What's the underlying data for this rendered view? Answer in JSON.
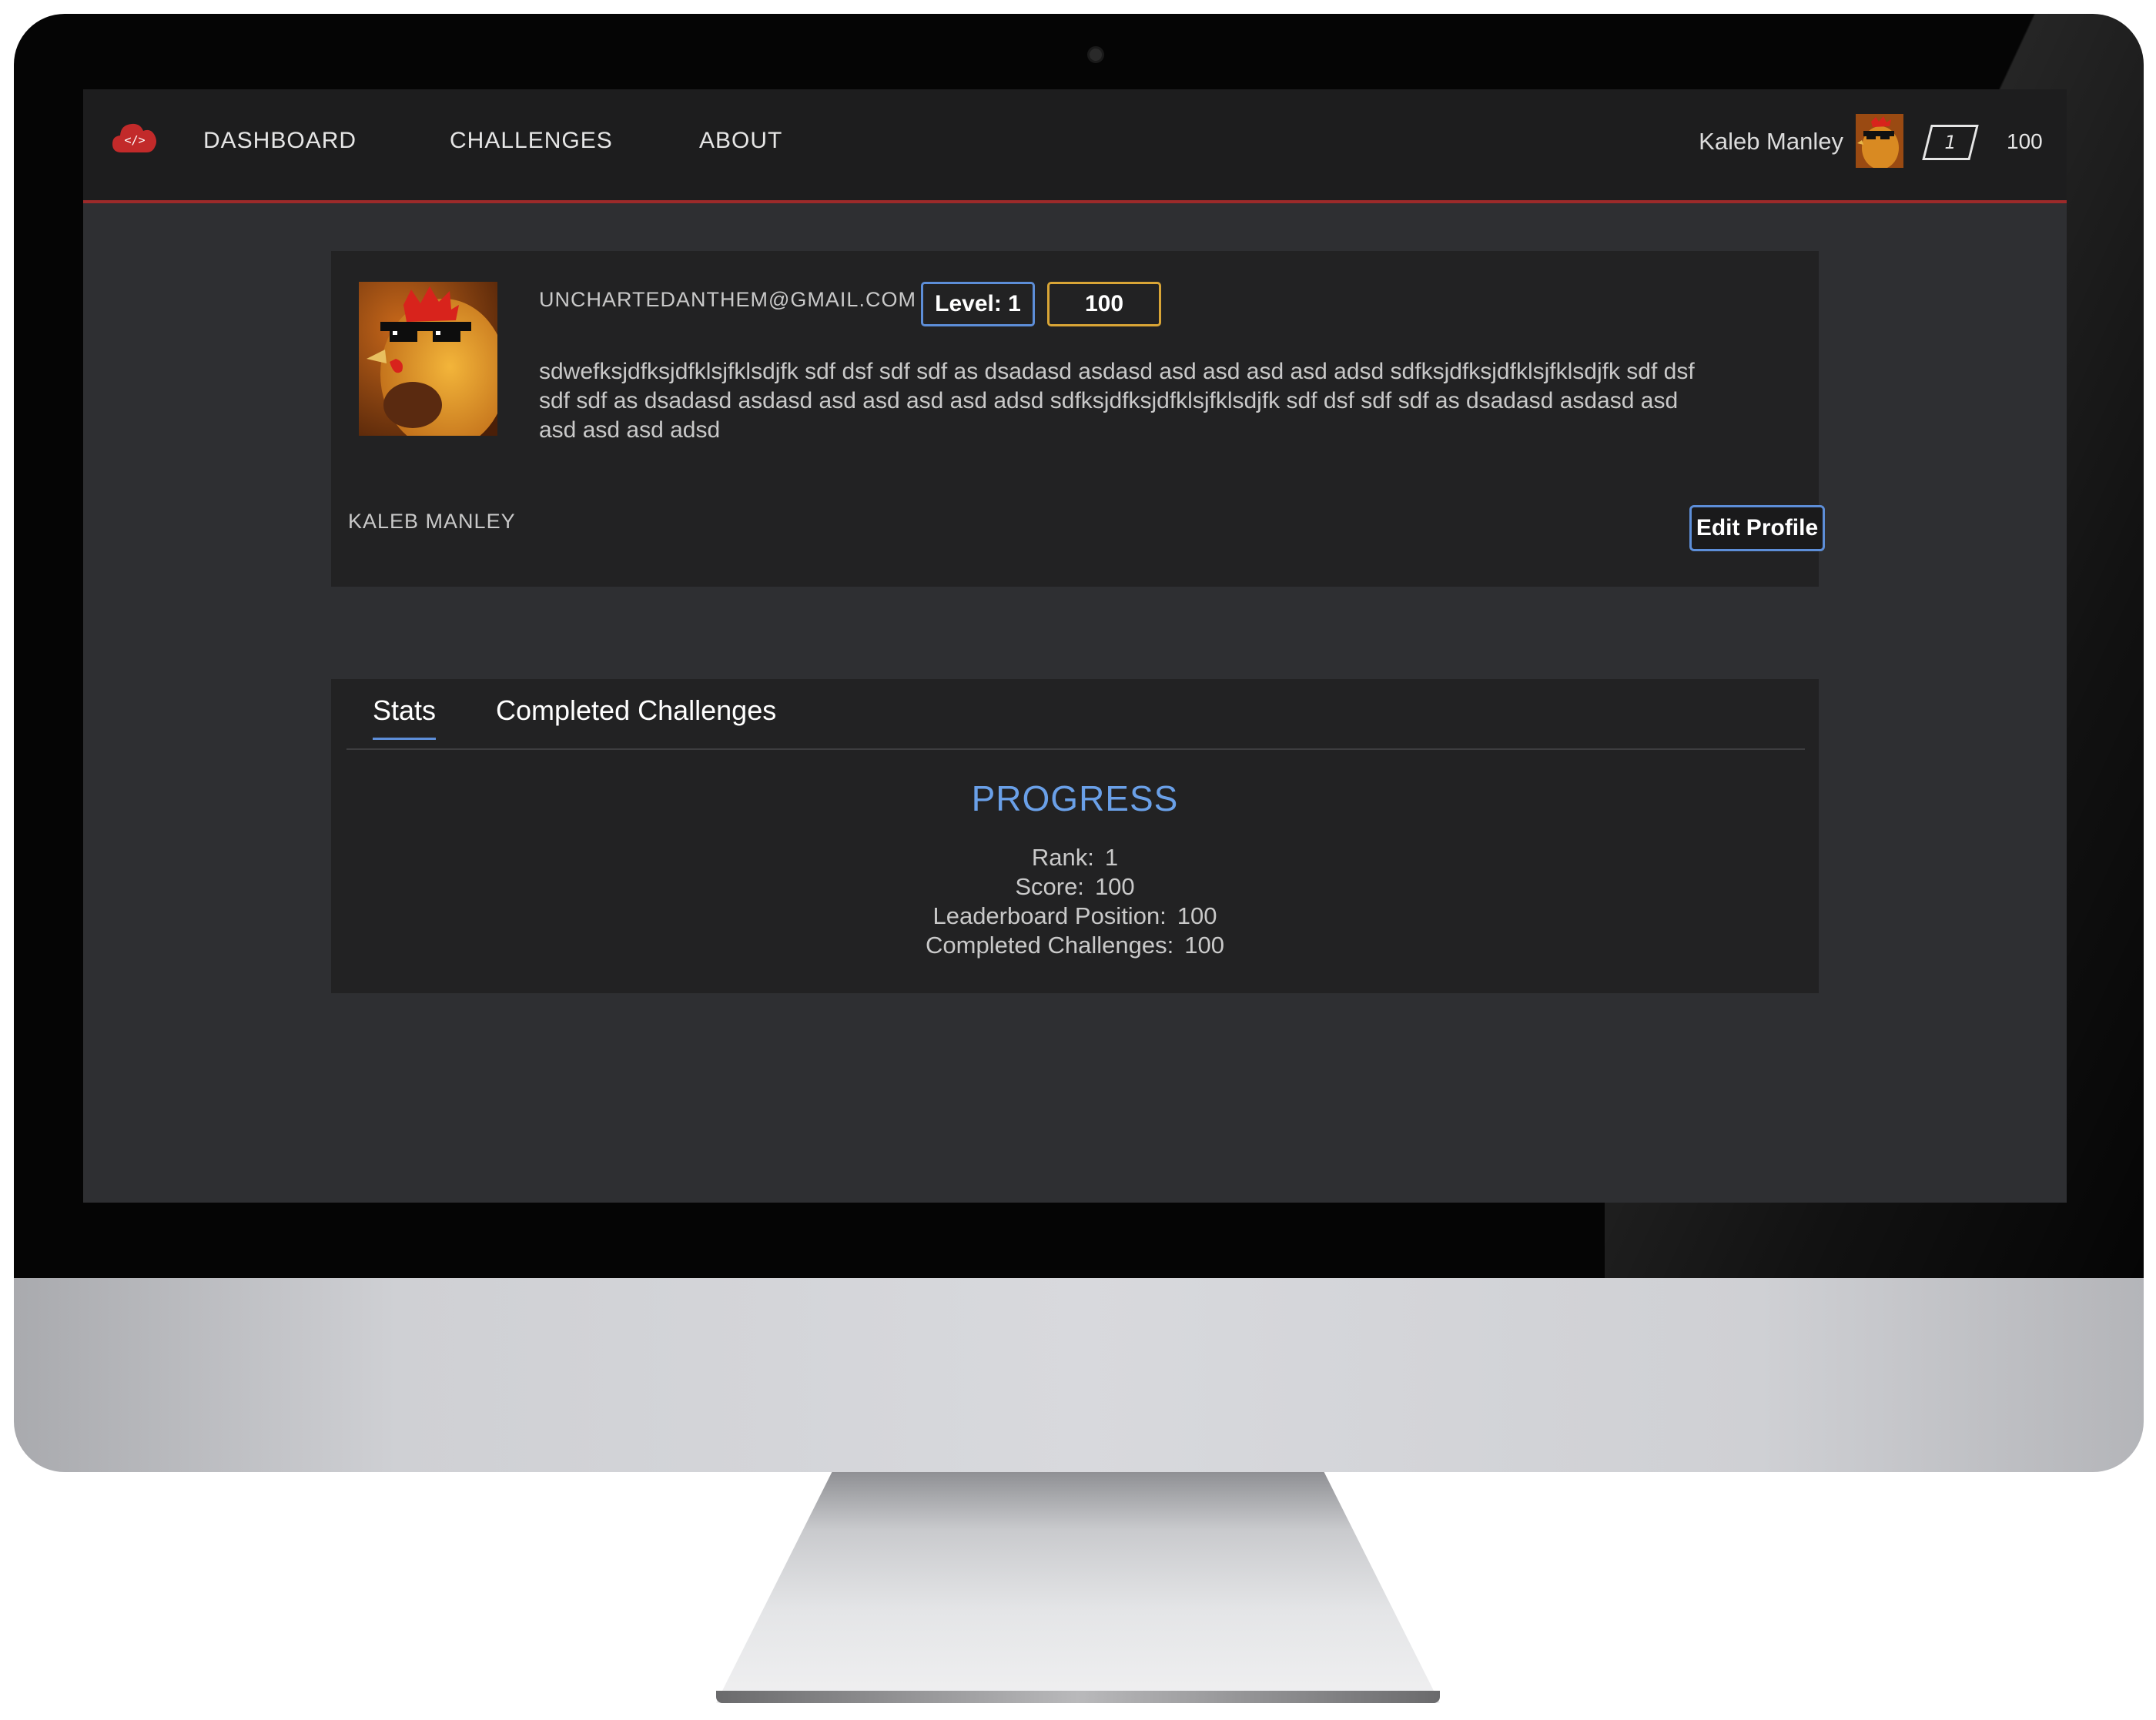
{
  "nav": {
    "links": [
      "DASHBOARD",
      "CHALLENGES",
      "ABOUT"
    ],
    "user_name": "Kaleb Manley",
    "level": "1",
    "points": "100",
    "accent_color": "#9c2a2a"
  },
  "profile": {
    "email": "UNCHARTEDANTHEM@GMAIL.COM",
    "level_badge": "Level: 1",
    "points_badge": "100",
    "bio": "sdwefksjdfksjdfklsjfklsdjfk sdf dsf sdf sdf as dsadasd asdasd asd asd asd asd adsd sdfksjdfksjdfklsjfklsdjfk sdf dsf sdf sdf as dsadasd asdasd asd asd asd asd adsd sdfksjdfksjdfklsjfklsdjfk sdf dsf sdf sdf as dsadasd asdasd asd asd asd asd adsd",
    "name": "KALEB MANLEY",
    "edit_button": "Edit Profile"
  },
  "tabs": {
    "items": [
      "Stats",
      "Completed Challenges"
    ],
    "active": "Stats"
  },
  "progress": {
    "title": "PROGRESS",
    "stats": [
      {
        "label": "Rank:",
        "value": "1"
      },
      {
        "label": "Score:",
        "value": "100"
      },
      {
        "label": "Leaderboard Position:",
        "value": "100"
      },
      {
        "label": "Completed Challenges:",
        "value": "100"
      }
    ]
  },
  "colors": {
    "level_badge_border": "#5d8ed8",
    "points_badge_border": "#d9a536",
    "progress_title": "#6aa0e8"
  }
}
